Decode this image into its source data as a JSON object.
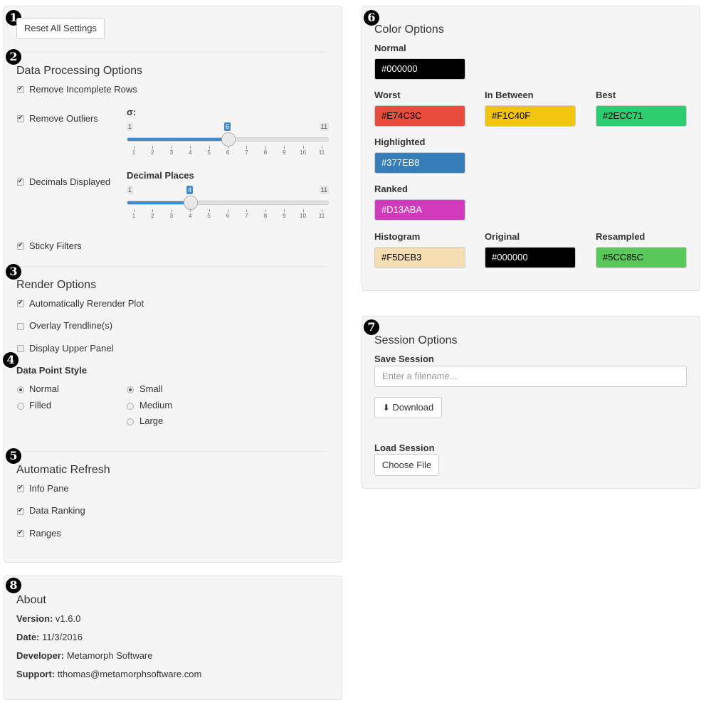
{
  "badges": [
    "1",
    "2",
    "3",
    "4",
    "5",
    "6",
    "7",
    "8"
  ],
  "reset_button": "Reset All Settings",
  "data_processing": {
    "title": "Data Processing Options",
    "remove_incomplete": "Remove Incomplete Rows",
    "remove_outliers": "Remove Outliers",
    "sigma_label": "σ:",
    "sigma_slider": {
      "min": 1,
      "max": 11,
      "value": 6
    },
    "decimals_displayed": "Decimals Displayed",
    "decimal_places_label": "Decimal Places",
    "decimal_slider": {
      "min": 1,
      "max": 11,
      "value": 4
    },
    "tick_labels": [
      "1",
      "2",
      "3",
      "4",
      "5",
      "6",
      "7",
      "8",
      "9",
      "10",
      "11"
    ],
    "sticky_filters": "Sticky Filters"
  },
  "render": {
    "title": "Render Options",
    "auto_rerender": "Automatically Rerender Plot",
    "overlay_trendline": "Overlay Trendline(s)",
    "display_upper_panel": "Display Upper Panel",
    "data_point_style": "Data Point Style",
    "style_normal": "Normal",
    "style_filled": "Filled",
    "size_small": "Small",
    "size_medium": "Medium",
    "size_large": "Large"
  },
  "auto_refresh": {
    "title": "Automatic Refresh",
    "info_pane": "Info Pane",
    "data_ranking": "Data Ranking",
    "ranges": "Ranges"
  },
  "about": {
    "title": "About",
    "version_label": "Version:",
    "version": "v1.6.0",
    "date_label": "Date:",
    "date": "11/3/2016",
    "developer_label": "Developer:",
    "developer": "Metamorph Software",
    "support_label": "Support:",
    "support": "tthomas@metamorphsoftware.com"
  },
  "color_options": {
    "title": "Color Options",
    "normal": {
      "label": "Normal",
      "value": "#000000",
      "bg": "#000000",
      "fg": "#ffffff"
    },
    "worst": {
      "label": "Worst",
      "value": "#E74C3C",
      "bg": "#E74C3C",
      "fg": "#000000"
    },
    "in_between": {
      "label": "In Between",
      "value": "#F1C40F",
      "bg": "#F1C40F",
      "fg": "#000000"
    },
    "best": {
      "label": "Best",
      "value": "#2ECC71",
      "bg": "#2ECC71",
      "fg": "#000000"
    },
    "highlighted": {
      "label": "Highlighted",
      "value": "#377EB8",
      "bg": "#377EB8",
      "fg": "#ffffff"
    },
    "ranked": {
      "label": "Ranked",
      "value": "#D13ABA",
      "bg": "#D13ABA",
      "fg": "#ffffff"
    },
    "histogram": {
      "label": "Histogram",
      "value": "#F5DEB3",
      "bg": "#F5DEB3",
      "fg": "#000000"
    },
    "original": {
      "label": "Original",
      "value": "#000000",
      "bg": "#000000",
      "fg": "#ffffff"
    },
    "resampled": {
      "label": "Resampled",
      "value": "#5CC85C",
      "bg": "#5CC85C",
      "fg": "#000000"
    }
  },
  "session": {
    "title": "Session Options",
    "save_label": "Save Session",
    "filename_placeholder": "Enter a filename...",
    "download": "Download",
    "load_label": "Load Session",
    "choose_file": "Choose File"
  }
}
